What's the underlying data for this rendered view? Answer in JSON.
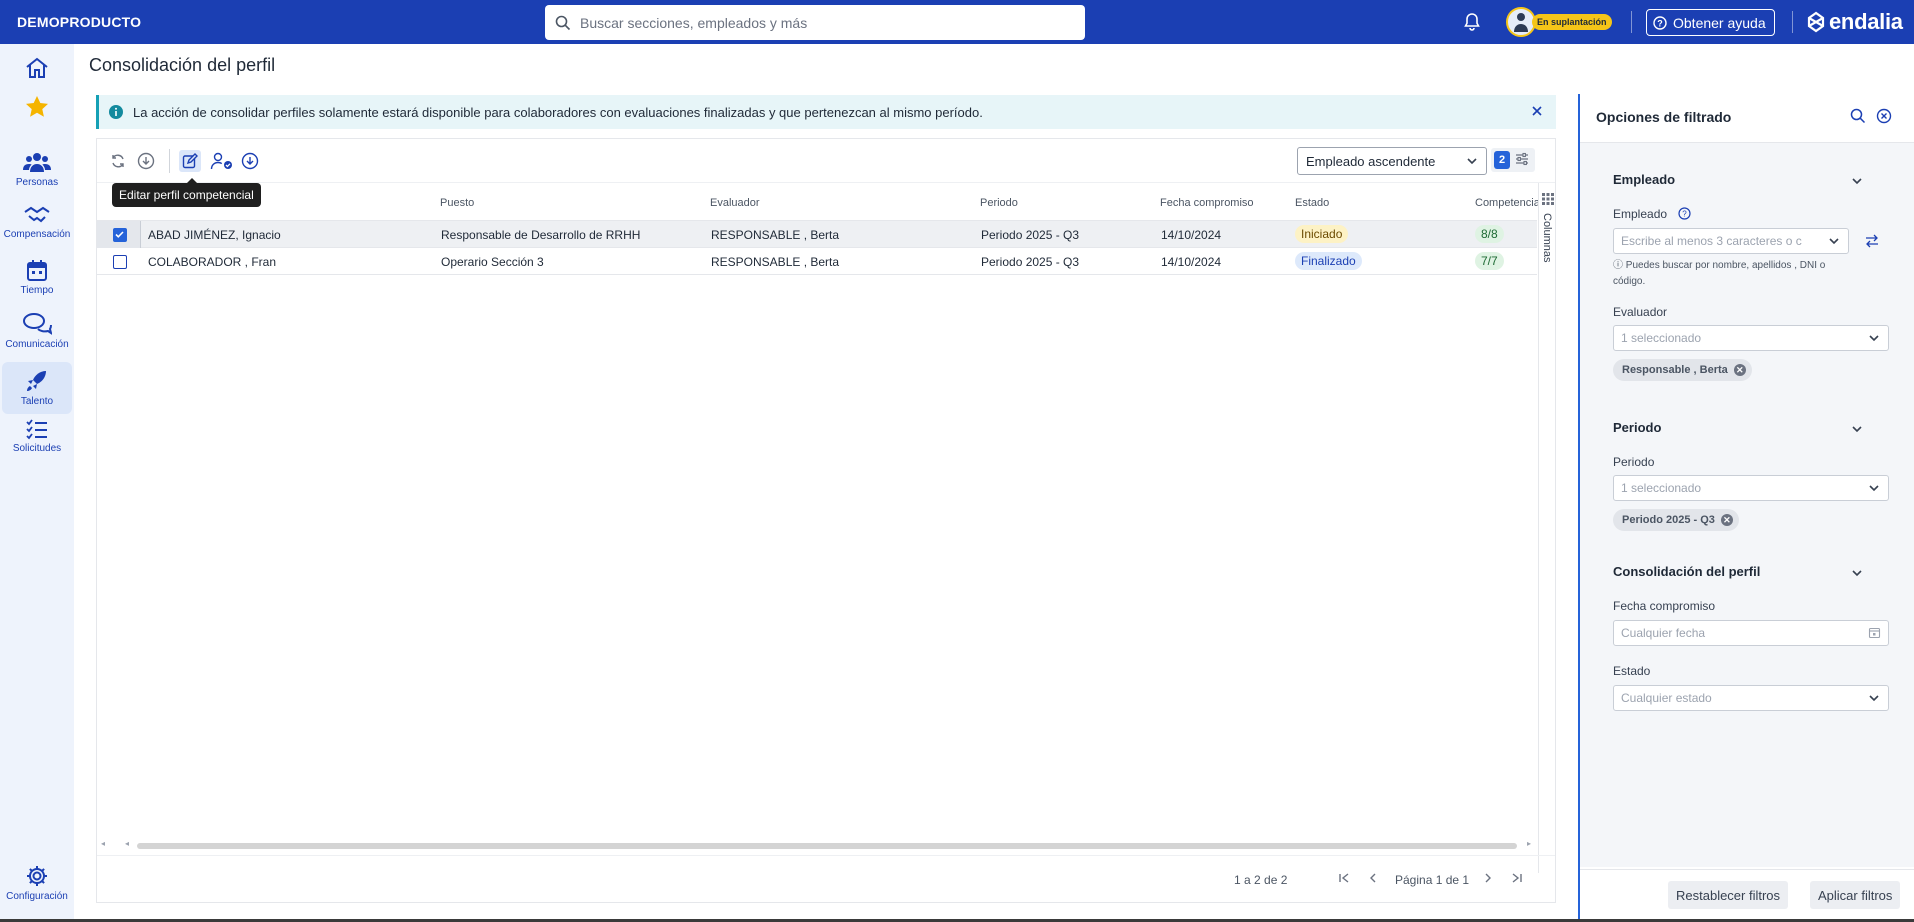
{
  "topbar": {
    "brand": "DEMOPRODUCTO",
    "search_placeholder": "Buscar secciones, empleados y más",
    "impersonation_badge": "En suplantación",
    "help_label": "Obtener ayuda",
    "logo": "endalia"
  },
  "sidebar": {
    "items": [
      {
        "label": "",
        "icon": "home-icon"
      },
      {
        "label": "",
        "icon": "star-icon"
      },
      {
        "label": "Personas",
        "icon": "people-icon"
      },
      {
        "label": "Compensación",
        "icon": "handshake-icon"
      },
      {
        "label": "Tiempo",
        "icon": "calendar-icon"
      },
      {
        "label": "Comunicación",
        "icon": "chat-icon"
      },
      {
        "label": "Talento",
        "icon": "rocket-icon",
        "active": true
      },
      {
        "label": "Solicitudes",
        "icon": "checklist-icon"
      },
      {
        "label": "Configuración",
        "icon": "gear-icon"
      }
    ]
  },
  "page": {
    "title": "Consolidación del perfil",
    "info_message": "La acción de consolidar perfiles solamente estará disponible para colaboradores con evaluaciones finalizadas y que pertenezcan al mismo período."
  },
  "toolbar": {
    "tooltip": "Editar perfil competencial",
    "sort_value": "Empleado ascendente",
    "filter_count": "2"
  },
  "table": {
    "columns": [
      "Puesto",
      "Evaluador",
      "Periodo",
      "Fecha compromiso",
      "Estado",
      "Competencia"
    ],
    "rows": [
      {
        "selected": true,
        "empleado": "ABAD JIMÉNEZ, Ignacio",
        "puesto": "Responsable de Desarrollo de RRHH",
        "evaluador": "RESPONSABLE , Berta",
        "periodo": "Periodo 2025 - Q3",
        "fecha": "14/10/2024",
        "estado": "Iniciado",
        "competencias": "8/8"
      },
      {
        "selected": false,
        "empleado": "COLABORADOR , Fran",
        "puesto": "Operario Sección 3",
        "evaluador": "RESPONSABLE , Berta",
        "periodo": "Periodo 2025 - Q3",
        "fecha": "14/10/2024",
        "estado": "Finalizado",
        "competencias": "7/7"
      }
    ],
    "columns_tab": "Columnas"
  },
  "pager": {
    "range": "1 a 2 de 2",
    "page_label": "Página 1 de 1"
  },
  "filters": {
    "title": "Opciones de filtrado",
    "empleado_section": "Empleado",
    "empleado_label": "Empleado",
    "empleado_placeholder": "Escribe al menos 3 caracteres o c",
    "empleado_hint": "ⓘ Puedes buscar por nombre, apellidos , DNI o código.",
    "evaluador_label": "Evaluador",
    "evaluador_value": "1 seleccionado",
    "evaluador_chip": "Responsable , Berta",
    "periodo_section": "Periodo",
    "periodo_label": "Periodo",
    "periodo_value": "1 seleccionado",
    "periodo_chip": "Periodo 2025 - Q3",
    "consolidacion_section": "Consolidación del perfil",
    "fecha_label": "Fecha compromiso",
    "fecha_placeholder": "Cualquier fecha",
    "estado_label": "Estado",
    "estado_placeholder": "Cualquier estado",
    "reset_label": "Restablecer filtros",
    "apply_label": "Aplicar filtros"
  }
}
